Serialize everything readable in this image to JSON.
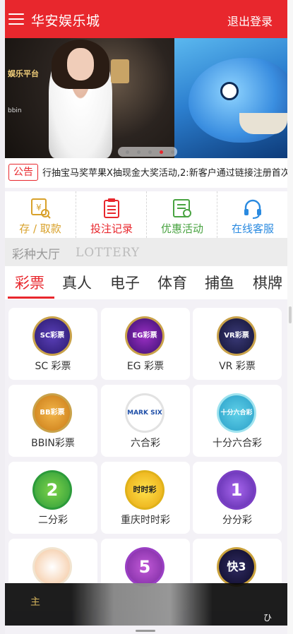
{
  "header": {
    "title": "华安娱乐城",
    "logout": "退出登录"
  },
  "banner": {
    "brand": "娱乐平台",
    "logo": "bbin",
    "dots": 5,
    "active_dot": 4
  },
  "notice": {
    "tag": "公告",
    "text": "行抽宝马奖苹果X抽现金大奖活动,2:新客户通过链接注册首次"
  },
  "quick_actions": [
    {
      "label": "存 / 取款",
      "color": "#d8a12a"
    },
    {
      "label": "投注记录",
      "color": "#e8272d"
    },
    {
      "label": "优惠活动",
      "color": "#49a341"
    },
    {
      "label": "在线客服",
      "color": "#2a8ae0"
    }
  ],
  "lottery_header": {
    "title": "彩种大厅",
    "subtitle": "LOTTERY"
  },
  "tabs": [
    "彩票",
    "真人",
    "电子",
    "体育",
    "捕鱼",
    "棋牌"
  ],
  "games": [
    {
      "label": "SC 彩票",
      "badge": "SC彩票"
    },
    {
      "label": "EG 彩票",
      "badge": "EG彩票"
    },
    {
      "label": "VR 彩票",
      "badge": "VR彩票"
    },
    {
      "label": "BBIN彩票",
      "badge": "BB彩票"
    },
    {
      "label": "六合彩",
      "badge": "MARK SIX"
    },
    {
      "label": "十分六合彩",
      "badge": "十分六合彩"
    },
    {
      "label": "二分彩",
      "badge": "2"
    },
    {
      "label": "重庆时时彩",
      "badge": "时时彩"
    },
    {
      "label": "分分彩",
      "badge": "1"
    },
    {
      "label": "",
      "badge": ""
    },
    {
      "label": "",
      "badge": "5"
    },
    {
      "label": "",
      "badge": "快3"
    }
  ],
  "bottom_bar": {
    "left": "主",
    "right": "ひ"
  },
  "colors": {
    "brand_red": "#e8272d",
    "tab_active": "#e8272d"
  }
}
